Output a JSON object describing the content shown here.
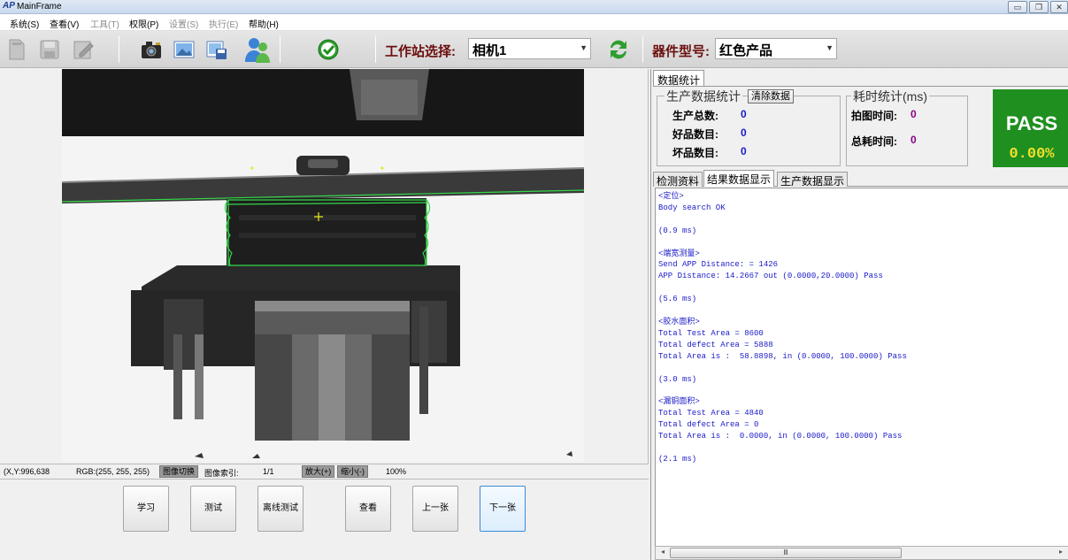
{
  "window": {
    "app_icon": "AP",
    "title": "MainFrame"
  },
  "menu": [
    {
      "label": "系统(S)",
      "disabled": false
    },
    {
      "label": "查看(V)",
      "disabled": false
    },
    {
      "label": "工具(T)",
      "disabled": true
    },
    {
      "label": "权限(P)",
      "disabled": false
    },
    {
      "label": "设置(S)",
      "disabled": true
    },
    {
      "label": "执行(E)",
      "disabled": true
    },
    {
      "label": "帮助(H)",
      "disabled": false
    }
  ],
  "toolbar": {
    "station_label": "工作站选择:",
    "station_value": "相机1",
    "part_label": "器件型号:",
    "part_value": "红色产品",
    "icons": [
      "new-file-icon",
      "save-icon",
      "edit-icon",
      "camera-icon",
      "image-icon",
      "save-image-icon",
      "users-icon",
      "check-run-icon",
      "refresh-icon"
    ]
  },
  "status": {
    "coords": "(X,Y:996,638",
    "rgb": "RGB:(255, 255, 255)",
    "image_switch": "图像切换",
    "image_index_label": "图像索引:",
    "image_index_value": "1/1",
    "zoom_in": "放大(+)",
    "zoom_out": "缩小(-)",
    "zoom_value": "100%"
  },
  "actions": {
    "learn": "学习",
    "test": "测试",
    "offline_test": "离线测试",
    "view": "查看",
    "prev": "上一张",
    "next": "下一张"
  },
  "stats": {
    "tab": "数据统计",
    "prod_title": "生产数据统计",
    "clear_btn": "清除数据",
    "total_label": "生产总数:",
    "total_value": "0",
    "good_label": "好品数目:",
    "good_value": "0",
    "bad_label": "坏品数目:",
    "bad_value": "0",
    "time_title": "耗时统计(ms)",
    "capture_label": "拍图时间:",
    "capture_value": "0",
    "total_time_label": "总耗时间:",
    "total_time_value": "0",
    "result": "PASS",
    "rate": "0.00%"
  },
  "tabs": [
    "检测资料",
    "结果数据显示",
    "生产数据显示"
  ],
  "active_tab": 1,
  "result_lines": [
    "<定位>",
    "Body search OK",
    "",
    "(0.9 ms)",
    "",
    "<端宽测量>",
    "Send APP Distance: = 1426",
    "APP Distance: 14.2667 out (0.0000,20.0000) Pass",
    "",
    "(5.6 ms)",
    "",
    "<胶水面积>",
    "Total Test Area = 8600",
    "Total defect Area = 5888",
    "Total Area is :  58.8898, in (0.0000, 100.0000) Pass",
    "",
    "(3.0 ms)",
    "",
    "<漏铜面积>",
    "Total Test Area = 4840",
    "Total defect Area = 0",
    "Total Area is :  0.0000, in (0.0000, 100.0000) Pass",
    "",
    "(2.1 ms)"
  ],
  "colors": {
    "pass_bg": "#1f8f1f",
    "pass_rate": "#f3e02a",
    "label_dark_red": "#6b0e0e",
    "value_blue": "#1a1ac8",
    "value_purple": "#8b008b",
    "roi_green": "#35d84a",
    "marker_yellow": "#e8e820"
  }
}
